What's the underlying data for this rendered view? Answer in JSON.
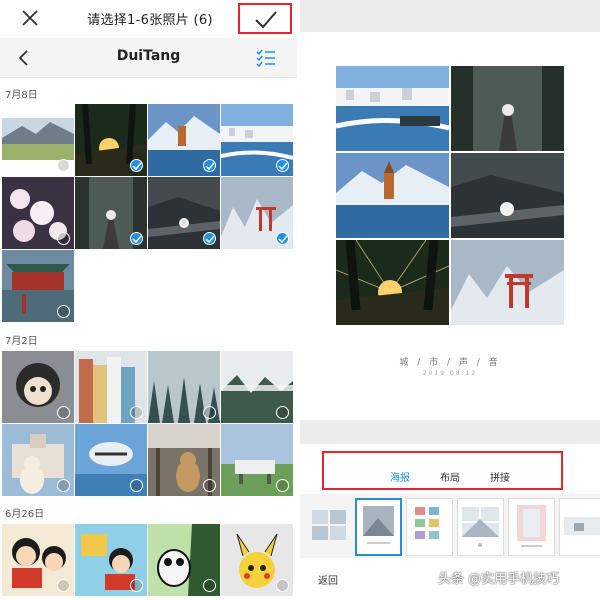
{
  "picker": {
    "title": "请选择1-6张照片 (6)",
    "album_name": "DuiTang",
    "close_icon": "close-icon",
    "confirm_icon": "checkmark-icon",
    "back_icon": "chevron-left-icon",
    "multiselect_icon": "multi-select-icon",
    "accent_color": "#1e90e6",
    "highlight_color": "#e5262f",
    "sections": [
      {
        "date": "7月8日"
      },
      {
        "date": "7月2日"
      },
      {
        "date": "6月26日"
      }
    ]
  },
  "editor": {
    "poster_title": "城 / 市 / 声 / 音",
    "poster_date": "2019.08.12",
    "modes": [
      {
        "label": "海报",
        "active": true
      },
      {
        "label": "布局",
        "active": false
      },
      {
        "label": "拼接",
        "active": false
      }
    ],
    "back_label": "返回",
    "watermark": "头条 @实用手机技巧"
  }
}
